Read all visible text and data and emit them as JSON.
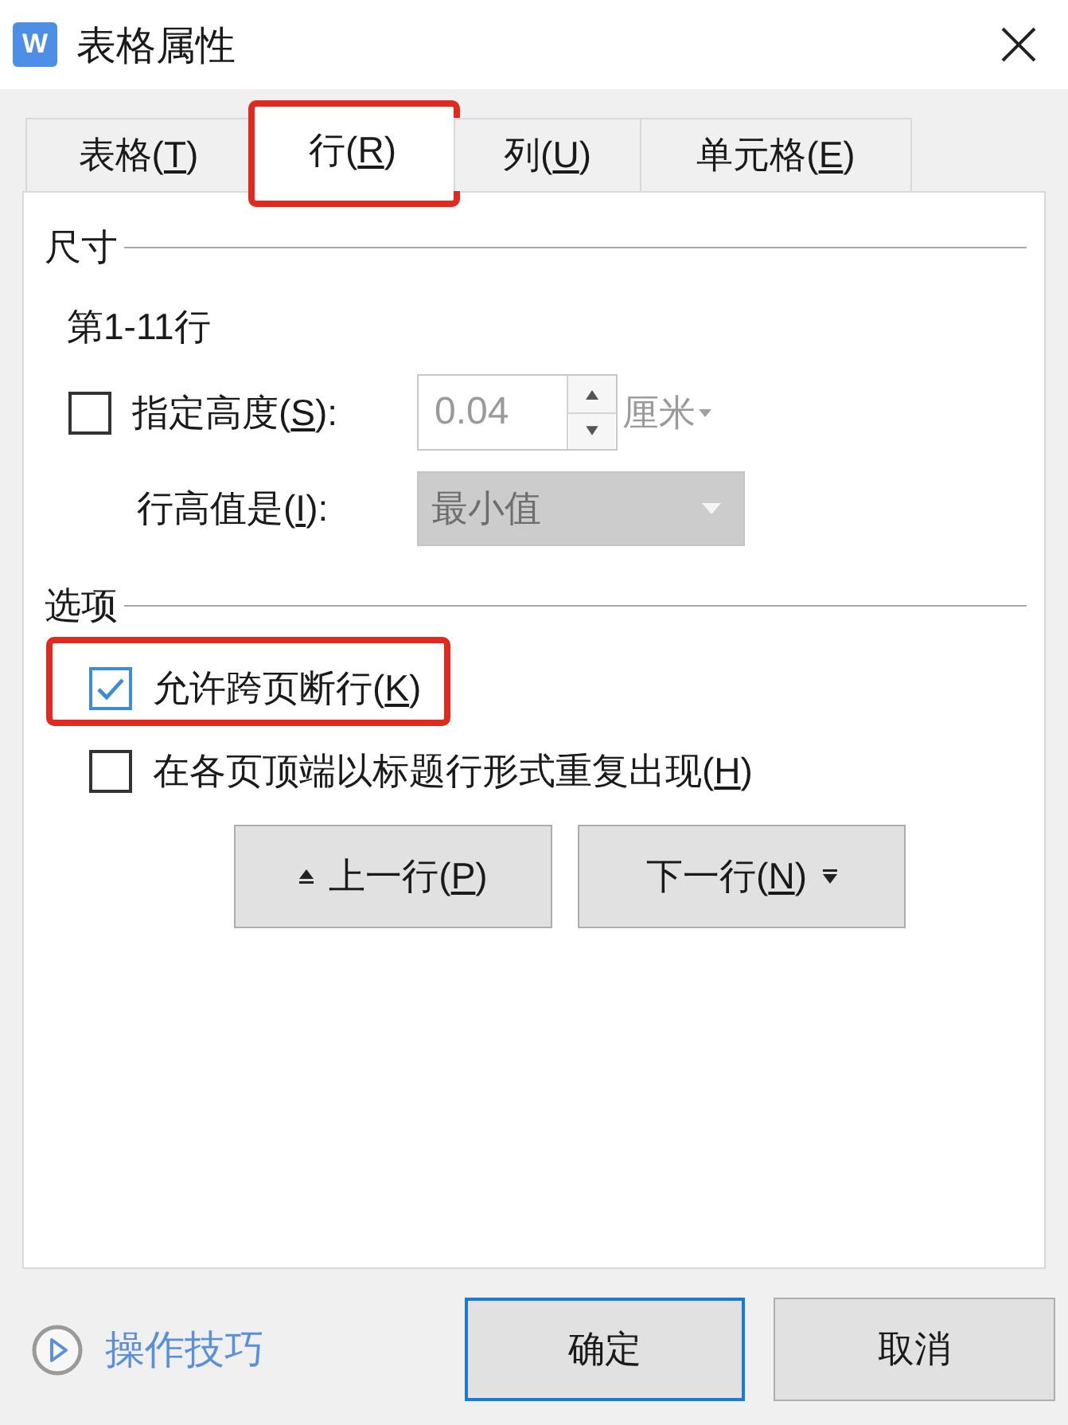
{
  "window": {
    "icon_letter": "W",
    "title": "表格属性"
  },
  "tabs": [
    {
      "label": {
        "pre": "表格(",
        "key": "T",
        "post": ")"
      },
      "selected": false,
      "highlighted": false
    },
    {
      "label": {
        "pre": "行(",
        "key": "R",
        "post": ")"
      },
      "selected": true,
      "highlighted": true
    },
    {
      "label": {
        "pre": "列(",
        "key": "U",
        "post": ")"
      },
      "selected": false,
      "highlighted": false
    },
    {
      "label": {
        "pre": "单元格(",
        "key": "E",
        "post": ")"
      },
      "selected": false,
      "highlighted": false
    }
  ],
  "size": {
    "heading": "尺寸",
    "rows_label": "第1-11行",
    "height": {
      "checked": false,
      "label": {
        "pre": "指定高度(",
        "key": "S",
        "post": "):"
      },
      "value": "0.04",
      "unit": "厘米",
      "disabled": true
    },
    "row_height": {
      "label": {
        "pre": "行高值是(",
        "key": "I",
        "post": "):"
      },
      "value": "最小值",
      "disabled": true
    }
  },
  "options": {
    "heading": "选项",
    "items": [
      {
        "label": {
          "pre": "允许跨页断行(",
          "key": "K",
          "post": ")"
        },
        "checked": true,
        "highlighted": true
      },
      {
        "label": {
          "pre": "在各页顶端以标题行形式重复出现(",
          "key": "H",
          "post": ")"
        },
        "checked": false,
        "highlighted": false
      }
    ]
  },
  "nav_buttons": [
    {
      "kind": "previous",
      "label": {
        "pre": "上一行(",
        "key": "P",
        "post": ")"
      }
    },
    {
      "kind": "next",
      "label": {
        "pre": "下一行(",
        "key": "N",
        "post": ")"
      }
    }
  ],
  "footer": {
    "tips_link": "操作技巧",
    "buttons": [
      {
        "label": "确定",
        "default": true
      },
      {
        "label": "取消",
        "default": false
      }
    ]
  }
}
